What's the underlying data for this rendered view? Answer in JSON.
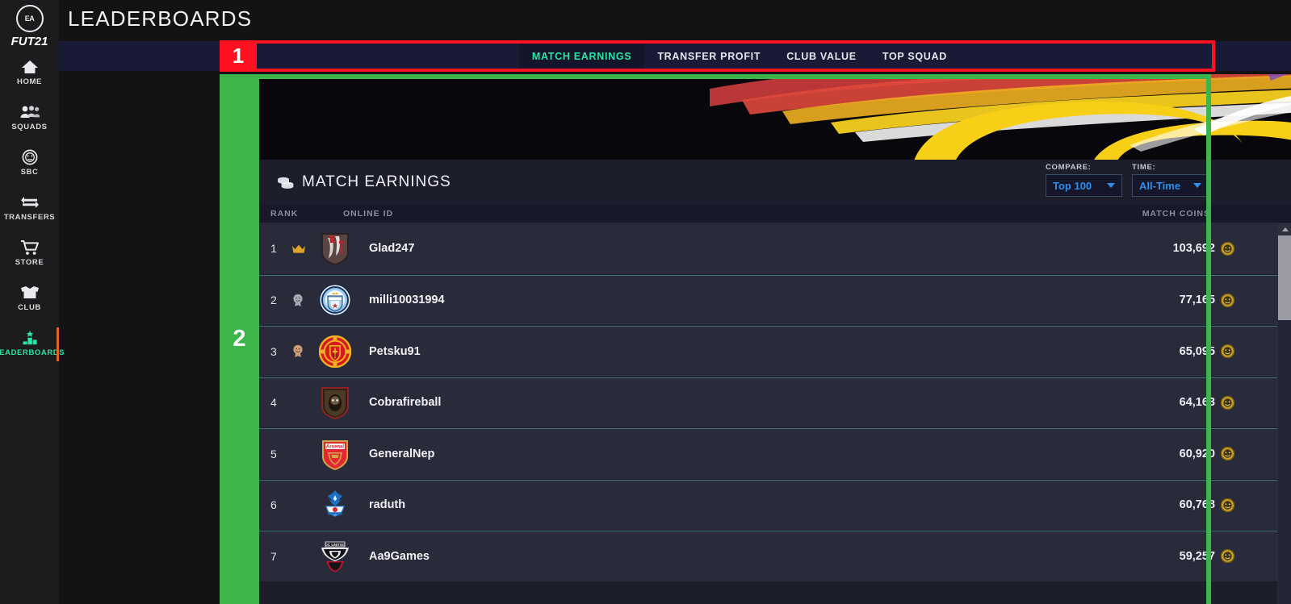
{
  "app": {
    "brand_mark": "EA SPORTS",
    "brand_text": "FUT21",
    "page_title": "LEADERBOARDS"
  },
  "sidebar": {
    "items": [
      {
        "label": "HOME",
        "icon": "home-icon",
        "active": false
      },
      {
        "label": "SQUADS",
        "icon": "squads-icon",
        "active": false
      },
      {
        "label": "SBC",
        "icon": "sbc-icon",
        "active": false
      },
      {
        "label": "TRANSFERS",
        "icon": "transfers-icon",
        "active": false
      },
      {
        "label": "STORE",
        "icon": "store-cart-icon",
        "active": false
      },
      {
        "label": "CLUB",
        "icon": "club-icon",
        "active": false
      },
      {
        "label": "LEADERBOARDS",
        "icon": "leaderboards-icon",
        "active": true
      }
    ],
    "active_accent_color": "#e2622a",
    "active_text_color": "#2ce4a3"
  },
  "tabbar": {
    "tabs": [
      {
        "label": "MATCH EARNINGS",
        "active": true
      },
      {
        "label": "TRANSFER PROFIT",
        "active": false
      },
      {
        "label": "CLUB VALUE",
        "active": false
      },
      {
        "label": "TOP SQUAD",
        "active": false
      }
    ],
    "background": "#181a36"
  },
  "annotations": [
    {
      "id": "1",
      "color": "#ff1122",
      "shape": "rectangle-outline",
      "target": "tabbar"
    },
    {
      "id": "2",
      "color": "#3cb54a",
      "shape": "rectangle-outline",
      "target": "leaderboard-panel"
    }
  ],
  "panel": {
    "title": "MATCH EARNINGS",
    "title_icon": "coins-stack-icon",
    "filters": [
      {
        "label": "COMPARE:",
        "value": "Top 100",
        "icon": "chevron-down-icon"
      },
      {
        "label": "TIME:",
        "value": "All-Time",
        "icon": "chevron-down-icon"
      }
    ],
    "filter_value_color": "#2f8fe8",
    "columns": {
      "rank": "RANK",
      "online_id": "ONLINE ID",
      "coins": "MATCH COINS"
    },
    "rows": [
      {
        "rank": "1",
        "medal": "gold-crown-icon",
        "club": "custom-dark-crest",
        "online_id": "Glad247",
        "coins": "103,692"
      },
      {
        "rank": "2",
        "medal": "silver-medal-icon",
        "club": "manchester-city",
        "online_id": "milli10031994",
        "coins": "77,165"
      },
      {
        "rank": "3",
        "medal": "bronze-medal-icon",
        "club": "manchester-united",
        "online_id": "Petsku91",
        "coins": "65,095"
      },
      {
        "rank": "4",
        "medal": "",
        "club": "dark-bear-crest",
        "online_id": "Cobrafireball",
        "coins": "64,163"
      },
      {
        "rank": "5",
        "medal": "",
        "club": "arsenal",
        "online_id": "GeneralNep",
        "coins": "60,920"
      },
      {
        "rank": "6",
        "medal": "",
        "club": "crystal-palace",
        "online_id": "raduth",
        "coins": "60,768"
      },
      {
        "rank": "7",
        "medal": "",
        "club": "dc-united",
        "online_id": "Aa9Games",
        "coins": "59,257"
      }
    ]
  },
  "scrollbar": {
    "up_arrow": "scroll-up-arrow-icon",
    "thumb": "scroll-thumb"
  }
}
